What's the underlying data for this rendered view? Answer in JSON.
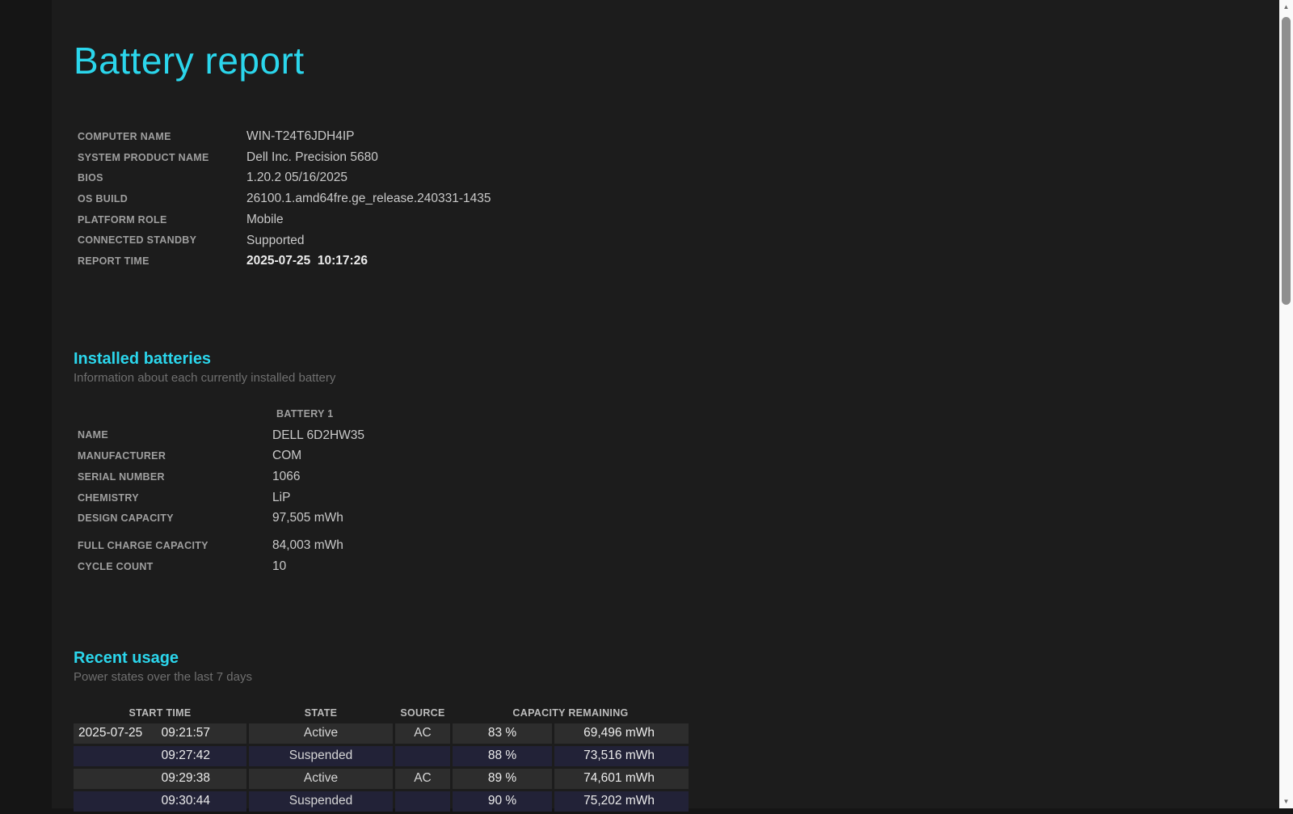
{
  "title": "Battery report",
  "colors": {
    "accent_cyan": "#2bd6ec",
    "page_background": "#1c1c1c",
    "row_active": "#2d2d2d",
    "row_suspended": "#222237",
    "scrollbar_track": "#f9f9f9",
    "scrollbar_thumb": "#8f8f8f"
  },
  "system_info": {
    "rows": [
      {
        "label": "COMPUTER NAME",
        "value": "WIN-T24T6JDH4IP",
        "style": "plain"
      },
      {
        "label": "SYSTEM PRODUCT NAME",
        "value": "Dell Inc. Precision 5680",
        "style": "plain"
      },
      {
        "label": "BIOS",
        "value": "1.20.2 05/16/2025",
        "style": "plain"
      },
      {
        "label": "OS BUILD",
        "value": "26100.1.amd64fre.ge_release.240331-1435",
        "style": "plain"
      },
      {
        "label": "PLATFORM ROLE",
        "value": "Mobile",
        "style": "plain"
      },
      {
        "label": "CONNECTED STANDBY",
        "value": "Supported",
        "style": "plain"
      },
      {
        "label": "REPORT TIME",
        "value": "2025-07-25  10:17:26",
        "style": "datetime"
      }
    ]
  },
  "installed_batteries": {
    "heading": "Installed batteries",
    "subtitle": "Information about each currently installed battery",
    "column_header": "BATTERY 1",
    "group1": [
      {
        "label": "NAME",
        "value": "DELL 6D2HW35",
        "style": "plain"
      },
      {
        "label": "MANUFACTURER",
        "value": "COM",
        "style": "plain"
      },
      {
        "label": "SERIAL NUMBER",
        "value": "1066",
        "style": "plain"
      },
      {
        "label": "CHEMISTRY",
        "value": "LiP",
        "style": "plain"
      },
      {
        "label": "DESIGN CAPACITY",
        "value": "97,505 mWh",
        "style": "plain"
      }
    ],
    "group2": [
      {
        "label": "FULL CHARGE CAPACITY",
        "value": "84,003 mWh",
        "style": "plain"
      },
      {
        "label": "CYCLE COUNT",
        "value": "10",
        "style": "plain"
      }
    ]
  },
  "recent_usage": {
    "heading": "Recent usage",
    "subtitle": "Power states over the last 7 days",
    "headers": {
      "start_time": "START TIME",
      "state": "STATE",
      "source": "SOURCE",
      "capacity_remaining": "CAPACITY REMAINING"
    },
    "rows": [
      {
        "date": "2025-07-25",
        "time": "09:21:57",
        "state": "Active",
        "source": "AC",
        "percent": "83 %",
        "mwh": "69,496 mWh",
        "variant": "active"
      },
      {
        "date": "",
        "time": "09:27:42",
        "state": "Suspended",
        "source": "",
        "percent": "88 %",
        "mwh": "73,516 mWh",
        "variant": "suspended"
      },
      {
        "date": "",
        "time": "09:29:38",
        "state": "Active",
        "source": "AC",
        "percent": "89 %",
        "mwh": "74,601 mWh",
        "variant": "active"
      },
      {
        "date": "",
        "time": "09:30:44",
        "state": "Suspended",
        "source": "",
        "percent": "90 %",
        "mwh": "75,202 mWh",
        "variant": "suspended"
      }
    ]
  },
  "scrollbar": {
    "up_icon": "▲",
    "down_icon": "▼"
  }
}
